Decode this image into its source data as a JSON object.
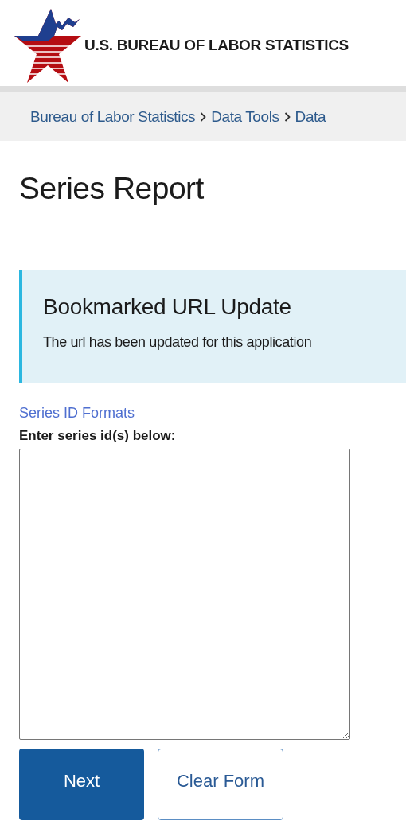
{
  "header": {
    "agency_name": "U.S. BUREAU OF LABOR STATISTICS"
  },
  "breadcrumb": [
    {
      "label": "Bureau of Labor Statistics"
    },
    {
      "label": "Data Tools"
    },
    {
      "label": "Data"
    }
  ],
  "page_title": "Series Report",
  "alert": {
    "title": "Bookmarked URL Update",
    "message": "The url has been updated for this application"
  },
  "form": {
    "help_link": "Series ID Formats",
    "label": "Enter series id(s) below:"
  },
  "buttons": [
    {
      "label": "Next",
      "kind": "primary"
    },
    {
      "label": "Clear Form",
      "kind": "secondary"
    }
  ]
}
